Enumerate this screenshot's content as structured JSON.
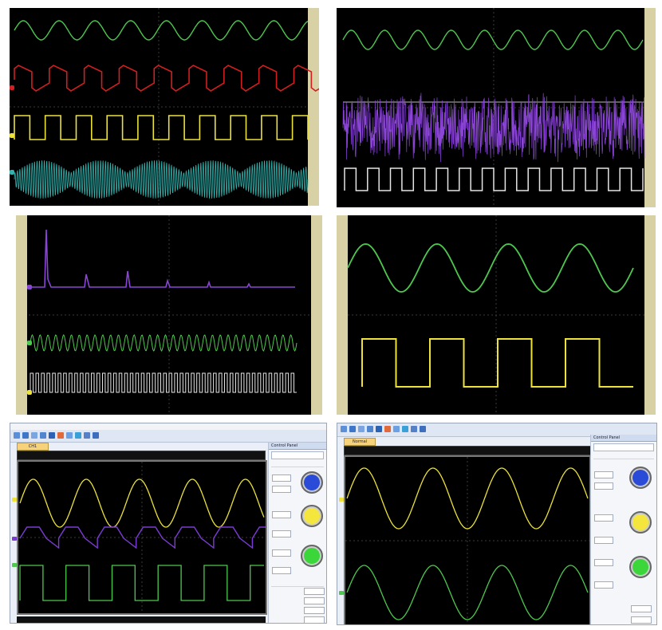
{
  "colors": {
    "background": "#000000",
    "grid": "#3a3a3a",
    "green": "#4ec84e",
    "red": "#d21f1f",
    "yellow": "#ece23a",
    "cyan": "#32b3ae",
    "purple": "#8a45d6",
    "white": "#e6e6e6",
    "panel_frame": "#d9d1a6"
  },
  "panels": [
    {
      "name": "four-channel-display",
      "traces": [
        "sine",
        "distorted-square",
        "square",
        "am-modulated"
      ]
    },
    {
      "name": "noise-display",
      "traces": [
        "sine",
        "noise",
        "square"
      ]
    },
    {
      "name": "fft-display",
      "traces": [
        "fft-spectrum",
        "sine-high-frequency",
        "square-high-frequency"
      ]
    },
    {
      "name": "two-channel-display",
      "traces": [
        "sine",
        "square"
      ]
    }
  ],
  "software_left": {
    "tab_label": "CH1",
    "side_panel_title": "Control Panel",
    "icons": [
      "new-icon",
      "open-icon",
      "save-icon",
      "print-icon",
      "cursor-icon",
      "measure-icon",
      "zoom-icon",
      "play-icon",
      "stop-icon",
      "single-icon"
    ]
  },
  "software_right": {
    "tab_label": "Normal",
    "side_panel_title": "Control Panel",
    "icons": [
      "new-icon",
      "open-icon",
      "save-icon",
      "print-icon",
      "cursor-icon",
      "measure-icon",
      "zoom-icon",
      "play-icon",
      "stop-icon",
      "single-icon"
    ]
  }
}
